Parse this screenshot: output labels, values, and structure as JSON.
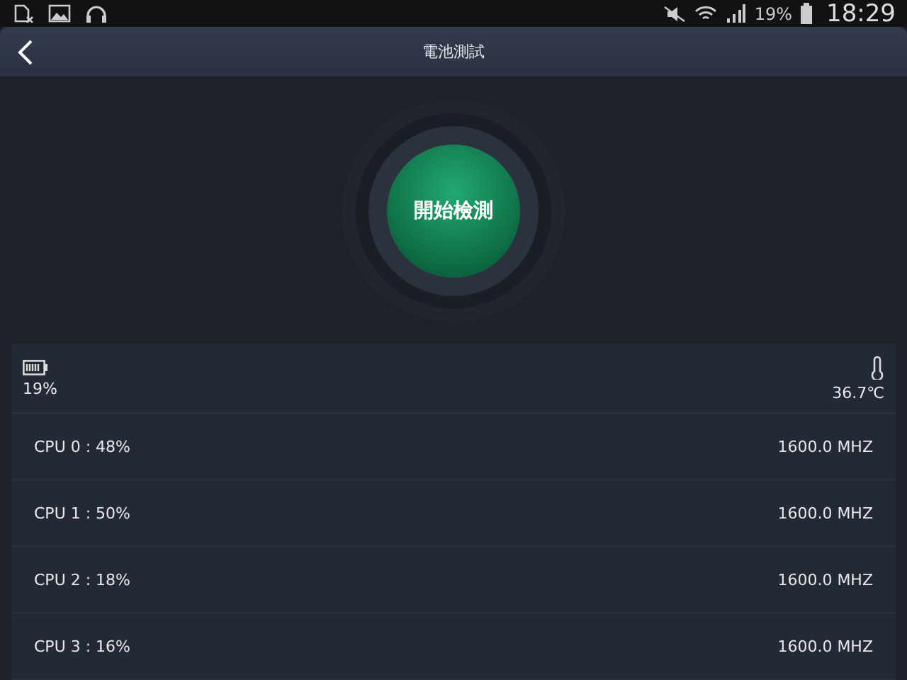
{
  "status_bar": {
    "battery": "19%",
    "time": "18:29"
  },
  "header": {
    "title": "電池測試"
  },
  "start_button": {
    "label": "開始檢測"
  },
  "summary": {
    "battery": "19%",
    "temperature": "36.7℃"
  },
  "cpus": [
    {
      "name": "CPU  0 : 48%",
      "frequency": "1600.0 MHZ"
    },
    {
      "name": "CPU  1 : 50%",
      "frequency": "1600.0 MHZ"
    },
    {
      "name": "CPU  2 : 18%",
      "frequency": "1600.0 MHZ"
    },
    {
      "name": "CPU  3 : 16%",
      "frequency": "1600.0 MHZ"
    }
  ]
}
